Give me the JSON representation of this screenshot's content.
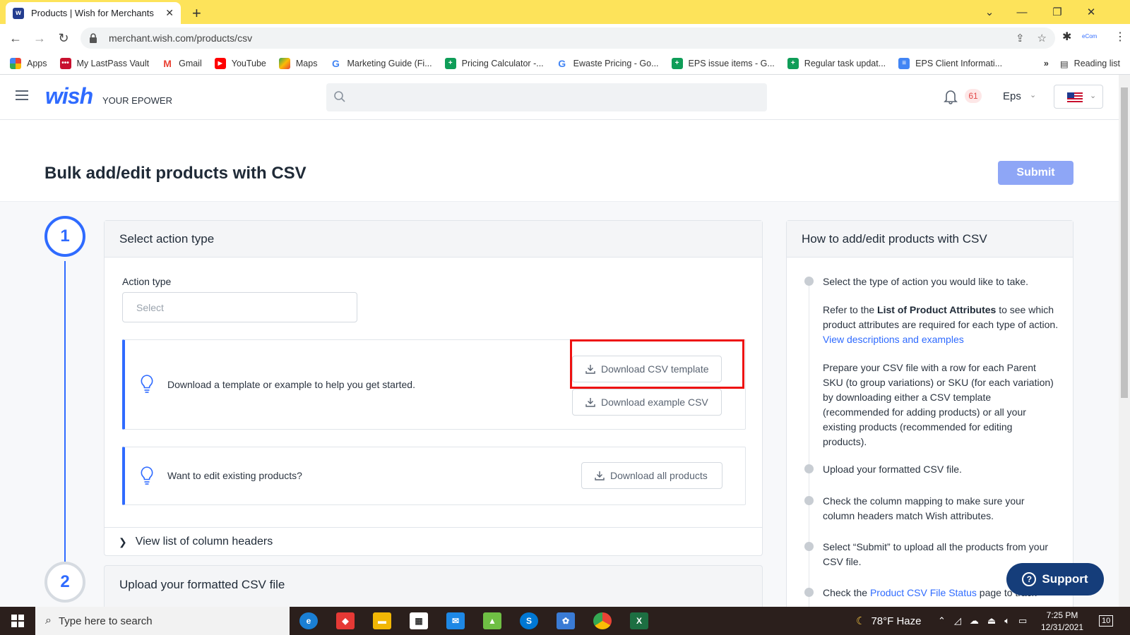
{
  "browser": {
    "tab_title": "Products | Wish for Merchants",
    "favicon_letter": "w",
    "url": "merchant.wish.com/products/csv",
    "bookmarks": [
      {
        "label": "Apps",
        "icon": "apps-grid-icon"
      },
      {
        "label": "My LastPass Vault",
        "icon": "lastpass-icon"
      },
      {
        "label": "Gmail",
        "icon": "gmail-icon"
      },
      {
        "label": "YouTube",
        "icon": "youtube-icon"
      },
      {
        "label": "Maps",
        "icon": "maps-icon"
      },
      {
        "label": "Marketing Guide (Fi...",
        "icon": "google-icon"
      },
      {
        "label": "Pricing Calculator -...",
        "icon": "sheets-icon"
      },
      {
        "label": "Ewaste Pricing - Go...",
        "icon": "google-icon"
      },
      {
        "label": "EPS issue items - G...",
        "icon": "sheets-icon"
      },
      {
        "label": "Regular task updat...",
        "icon": "sheets-icon"
      },
      {
        "label": "EPS Client Informati...",
        "icon": "docs-icon"
      }
    ],
    "bookmarks_more": "»",
    "reading_list": "Reading list"
  },
  "header": {
    "logo": "wish",
    "store_name": "YOUR EPOWER",
    "notification_count": "61",
    "user_name": "Eps"
  },
  "page": {
    "title": "Bulk add/edit products with CSV",
    "submit_label": "Submit",
    "step1_number": "1",
    "step2_number": "2",
    "step1_title": "Select action type",
    "action_type_label": "Action type",
    "action_type_placeholder": "Select",
    "tip1_text": "Download a template or example to help you get started.",
    "download_template_label": "Download CSV template",
    "download_example_label": "Download example CSV",
    "tip2_text": "Want to edit existing products?",
    "download_all_label": "Download all products",
    "view_columns_label": "View list of column headers",
    "step2_title": "Upload your formatted CSV file"
  },
  "help": {
    "title": "How to add/edit products with CSV",
    "step1": "Select the type of action you would like to take.",
    "step1_p2_a": "Refer to the ",
    "step1_p2_bold": "List of Product Attributes",
    "step1_p2_b": " to see which product attributes are required for each type of action. ",
    "step1_p2_link": "View descriptions and examples",
    "step1_p3": "Prepare your CSV file with a row for each Parent SKU (to group variations) or SKU (for each variation) by downloading either a CSV template (recommended for adding products) or all your existing products (recommended for editing products).",
    "step2": "Upload your formatted CSV file.",
    "step3": "Check the column mapping to make sure your column headers match Wish attributes.",
    "step4": "Select “Submit” to upload all the products from your CSV file.",
    "step5_a": "Check the ",
    "step5_link": "Product CSV File Status",
    "step5_b": " page to track"
  },
  "support_label": "Support",
  "taskbar": {
    "search_placeholder": "Type here to search",
    "weather": "78°F  Haze",
    "time": "7:25 PM",
    "date": "12/31/2021",
    "notification_badge": "10"
  },
  "colors": {
    "accent": "#2f6bff",
    "submit_disabled": "#8ea6f6",
    "highlight_box": "#ee1111",
    "tab_bar": "#fde35a",
    "support": "#153d7a"
  }
}
